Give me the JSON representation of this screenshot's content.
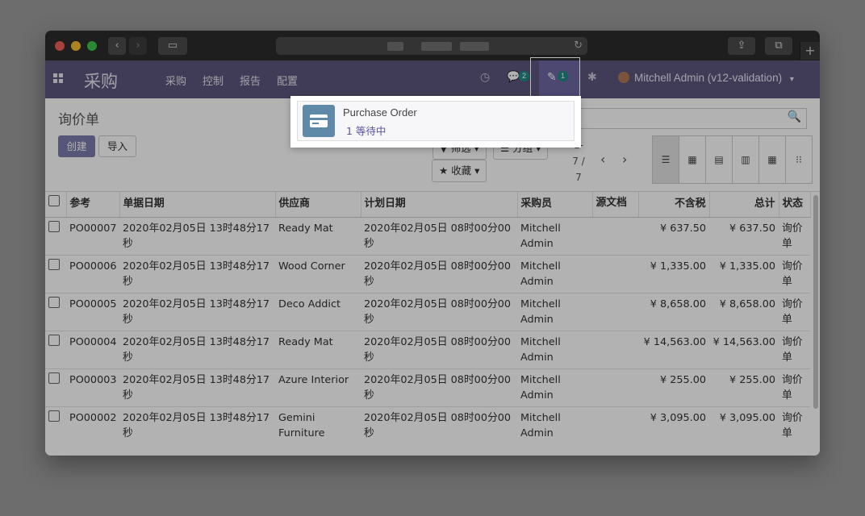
{
  "browser": {
    "back": "‹",
    "forward": "›",
    "sidebar": "▭",
    "reload": "↻",
    "share": "⇪",
    "tabs": "⧉",
    "new_tab": "+"
  },
  "nav": {
    "brand": "采购",
    "menus": [
      "采购",
      "控制",
      "报告",
      "配置"
    ],
    "messages_count": "2",
    "activity_count": "1",
    "user": "Mitchell Admin (v12-validation)",
    "user_caret": "▾",
    "clock_icon": "◷",
    "chat_icon": "💬",
    "activity_icon": "✎",
    "bug_icon": "✱"
  },
  "control": {
    "title": "询价单",
    "create": "创建",
    "import": "导入",
    "filters": "▼ 筛选 ▾",
    "group": "☰ 分组 ▾",
    "favorites": "★ 收藏 ▾",
    "pager_line1": "1-",
    "pager_line2": "7 /",
    "pager_line3": "7",
    "prev": "‹",
    "next": "›",
    "search_icon": "🔍"
  },
  "views": [
    "☰",
    "▦",
    "▤",
    "▥",
    "▦",
    "⁝⁝"
  ],
  "table": {
    "headers": [
      "参考",
      "单据日期",
      "供应商",
      "计划日期",
      "采购员",
      "源文档",
      "不含税",
      "总计",
      "状态"
    ],
    "rows": [
      [
        "PO00007",
        "2020年02月05日 13时48分17秒",
        "Ready Mat",
        "2020年02月05日 08时00分00秒",
        "Mitchell Admin",
        "",
        "¥ 637.50",
        "¥ 637.50",
        "询价单"
      ],
      [
        "PO00006",
        "2020年02月05日 13时48分17秒",
        "Wood Corner",
        "2020年02月05日 08时00分00秒",
        "Mitchell Admin",
        "",
        "¥ 1,335.00",
        "¥ 1,335.00",
        "询价单"
      ],
      [
        "PO00005",
        "2020年02月05日 13时48分17秒",
        "Deco Addict",
        "2020年02月05日 08时00分00秒",
        "Mitchell Admin",
        "",
        "¥ 8,658.00",
        "¥ 8,658.00",
        "询价单"
      ],
      [
        "PO00004",
        "2020年02月05日 13时48分17秒",
        "Ready Mat",
        "2020年02月05日 08时00分00秒",
        "Mitchell Admin",
        "",
        "¥ 14,563.00",
        "¥ 14,563.00",
        "询价单"
      ],
      [
        "PO00003",
        "2020年02月05日 13时48分17秒",
        "Azure Interior",
        "2020年02月05日 08时00分00秒",
        "Mitchell Admin",
        "",
        "¥ 255.00",
        "¥ 255.00",
        "询价单"
      ],
      [
        "PO00002",
        "2020年02月05日 13时48分17秒",
        "Gemini Furniture",
        "2020年02月05日 08时00分00秒",
        "Mitchell Admin",
        "",
        "¥ 3,095.00",
        "¥ 3,095.00",
        "询价单"
      ]
    ]
  },
  "activity_dropdown": {
    "name": "Purchase Order",
    "pending": "1 等待中"
  }
}
